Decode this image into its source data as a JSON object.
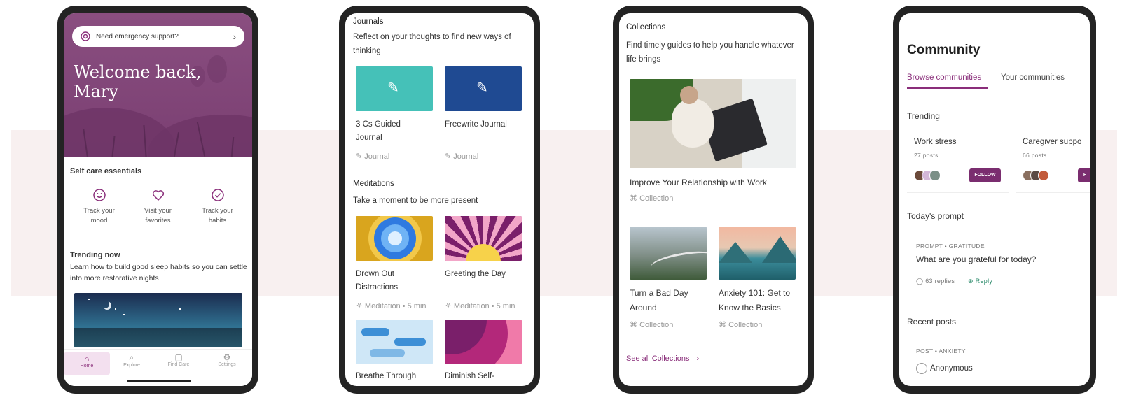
{
  "colors": {
    "brand": "#8a2e7a",
    "hero": "#8a4e80",
    "journal1": "#45c1b8",
    "journal2": "#1f4a92"
  },
  "home": {
    "emergency": "Need emergency support?",
    "welcome_line1": "Welcome back,",
    "welcome_line2": "Mary",
    "self_care_title": "Self care essentials",
    "self_care": [
      {
        "icon": "smiley-icon",
        "l1": "Track your",
        "l2": "mood"
      },
      {
        "icon": "heart-icon",
        "l1": "Visit your",
        "l2": "favorites"
      },
      {
        "icon": "check-circle-icon",
        "l1": "Track your",
        "l2": "habits"
      }
    ],
    "trending_title": "Trending now",
    "trending_desc": "Learn how to build good sleep habits so you can settle into more restorative nights",
    "tabs": [
      "Home",
      "Explore",
      "Find Care",
      "Settings"
    ]
  },
  "explore": {
    "journals_title": "Journals",
    "journals_desc": "Reflect on your thoughts to find new ways of thinking",
    "journals": [
      {
        "l1": "3 Cs Guided",
        "l2": "Journal",
        "meta": "Journal"
      },
      {
        "l1": "Freewrite Journal",
        "l2": "",
        "meta": "Journal"
      }
    ],
    "meditations_title": "Meditations",
    "meditations_desc": "Take a moment to be more present",
    "meditations": [
      {
        "l1": "Drown Out",
        "l2": "Distractions",
        "meta": "Meditation • 5 min"
      },
      {
        "l1": "Greeting the Day",
        "l2": "",
        "meta": "Meditation • 5 min"
      }
    ],
    "more": [
      {
        "l1": "Breathe Through"
      },
      {
        "l1": "Diminish Self-"
      }
    ]
  },
  "collections": {
    "title": "Collections",
    "desc": "Find timely guides to help you handle whatever life brings",
    "feature": {
      "title": "Improve Your Relationship with Work",
      "meta": "Collection"
    },
    "cards": [
      {
        "l1": "Turn a Bad Day",
        "l2": "Around",
        "meta": "Collection"
      },
      {
        "l1": "Anxiety 101: Get to",
        "l2": "Know the Basics",
        "meta": "Collection"
      }
    ],
    "see_all": "See all Collections"
  },
  "community": {
    "title": "Community",
    "tabs": [
      "Browse communities",
      "Your communities"
    ],
    "trending_title": "Trending",
    "groups": [
      {
        "name": "Work stress",
        "posts": "27 posts",
        "follow": "FOLLOW"
      },
      {
        "name": "Caregiver suppo",
        "posts": "66 posts",
        "follow": "F"
      }
    ],
    "prompt_title": "Today's prompt",
    "prompt_tag": "PROMPT • GRATITUDE",
    "prompt_q": "What are you grateful for today?",
    "replies": "63 replies",
    "reply": "Reply",
    "recent_title": "Recent posts",
    "post_tag": "POST • ANXIETY",
    "post_author": "Anonymous"
  }
}
